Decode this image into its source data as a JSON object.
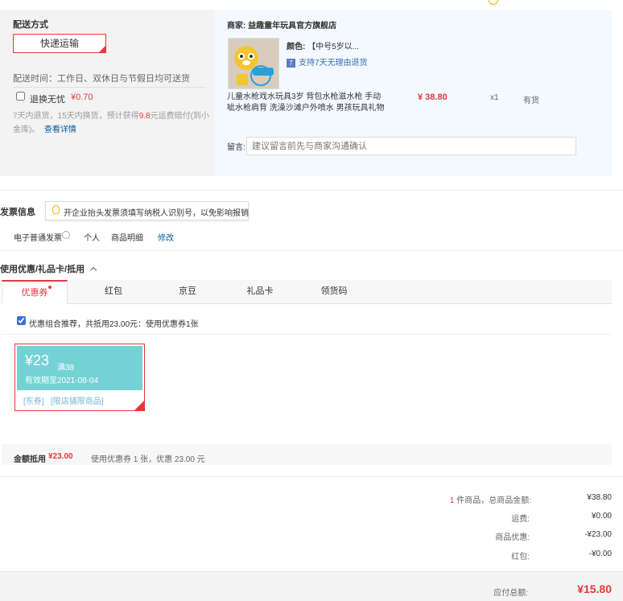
{
  "shipping": {
    "title": "配送方式",
    "method": "快递运输",
    "delivery_time": "配送时间：工作日、双休日与节假日均可送货",
    "return_label": "退换无忧",
    "return_price": "¥0.70",
    "return_desc_1": "7天内退货，15天内换货，预计获得",
    "return_amount": "9.8",
    "return_desc_2": "元运费赔付(到小",
    "return_desc_3": "金库)。",
    "return_link": "查看详情"
  },
  "merchant": {
    "label": "商家:",
    "name": "益趣童年玩具官方旗舰店",
    "color_label": "颜色:",
    "color_value": "【中号5岁以...",
    "return_badge": "支持7天无理由退货",
    "product_name_1": "儿童水枪戏水玩具3岁 背包水枪滋水枪 手动",
    "product_name_2": "呲水枪肩背 洗澡沙滩户外喷水 男孩玩具礼物",
    "price": "¥ 38.80",
    "qty": "x1",
    "stock": "有货",
    "note_label": "留言:",
    "note_placeholder": "建议留言前先与商家沟通确认"
  },
  "invoice": {
    "title": "发票信息",
    "tip": "开企业抬头发票须填写纳税人识别号，以免影响报销",
    "type": "电子普通发票",
    "person": "个人",
    "detail": "商品明细",
    "edit": "修改"
  },
  "discount": {
    "title": "使用优惠/礼品卡/抵用",
    "tabs": [
      "优惠券",
      "红包",
      "京豆",
      "礼品卡",
      "领货码"
    ],
    "combo_text": "优惠组合推荐，共抵用23.00元：使用优惠券1张",
    "coupon": {
      "amount": "¥23",
      "condition": "满38",
      "expiry": "有效期至2021-08-04",
      "tag1": "[东券]",
      "tag2": "[限店铺限商品]"
    },
    "footer_label": "金额抵用",
    "footer_amount": "¥23.00",
    "footer_desc": "使用优惠券 1 张，优惠 23.00 元"
  },
  "summary": {
    "count": "1",
    "count_label": "件商品，总商品金额:",
    "total_goods": "¥38.80",
    "shipping_label": "运费:",
    "shipping_val": "¥0.00",
    "goods_discount_label": "商品优惠:",
    "goods_discount_val": "-¥23.00",
    "redpacket_label": "红包:",
    "redpacket_val": "-¥0.00",
    "payable_label": "应付总额:",
    "payable_val": "¥15.80"
  },
  "colors": {
    "accent": "#e4393c",
    "coupon": "#74d2d4",
    "link": "#005aa0"
  }
}
